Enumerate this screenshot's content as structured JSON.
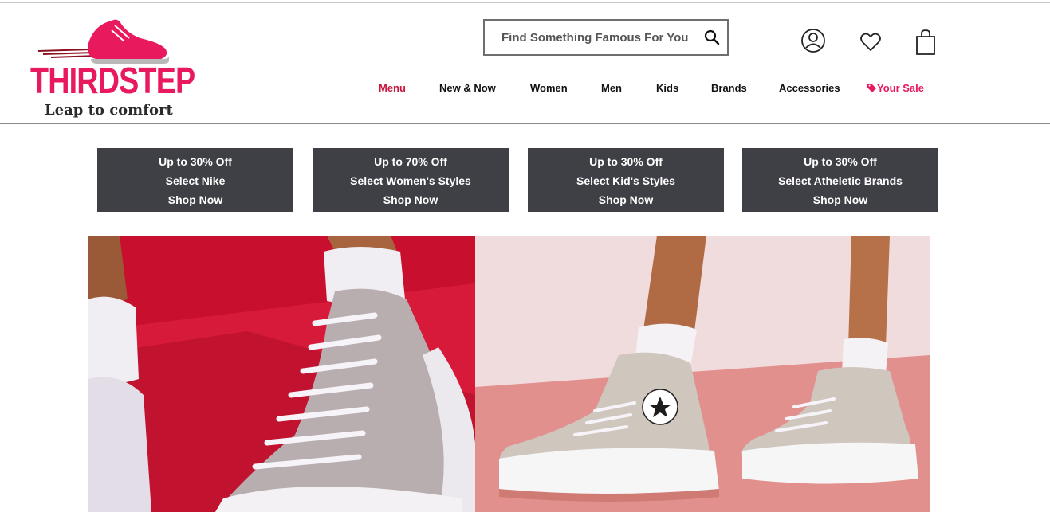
{
  "brand": {
    "name": "THIRDSTEP",
    "tagline": "Leap to comfort",
    "accent": "#e8195c"
  },
  "search": {
    "placeholder": "Find Something Famous For You",
    "icon": "search-icon"
  },
  "header_icons": [
    "user-icon",
    "heart-icon",
    "shopping-bag-icon"
  ],
  "nav": {
    "items": [
      {
        "label": "Menu",
        "active": true
      },
      {
        "label": "New & Now"
      },
      {
        "label": "Women"
      },
      {
        "label": "Men"
      },
      {
        "label": "Kids"
      },
      {
        "label": "Brands"
      },
      {
        "label": "Accessories"
      },
      {
        "label": "Your Sale",
        "icon": "tag-icon"
      }
    ]
  },
  "promos": [
    {
      "line1": "Up to 30% Off",
      "line2": "Select Nike",
      "cta": "Shop Now"
    },
    {
      "line1": "Up to 70% Off",
      "line2": "Select Women's Styles",
      "cta": "Shop Now"
    },
    {
      "line1": "Up to 30% Off",
      "line2": "Select Kid's Styles",
      "cta": "Shop Now"
    },
    {
      "line1": "Up to 30% Off",
      "line2": "Select Atheletic Brands",
      "cta": "Shop Now"
    }
  ],
  "colors": {
    "promo_bg": "#3f4045",
    "menu_active": "#c8183e",
    "hero_left_bg": "#c8102e",
    "hero_right_bg": "#e79a9a"
  }
}
